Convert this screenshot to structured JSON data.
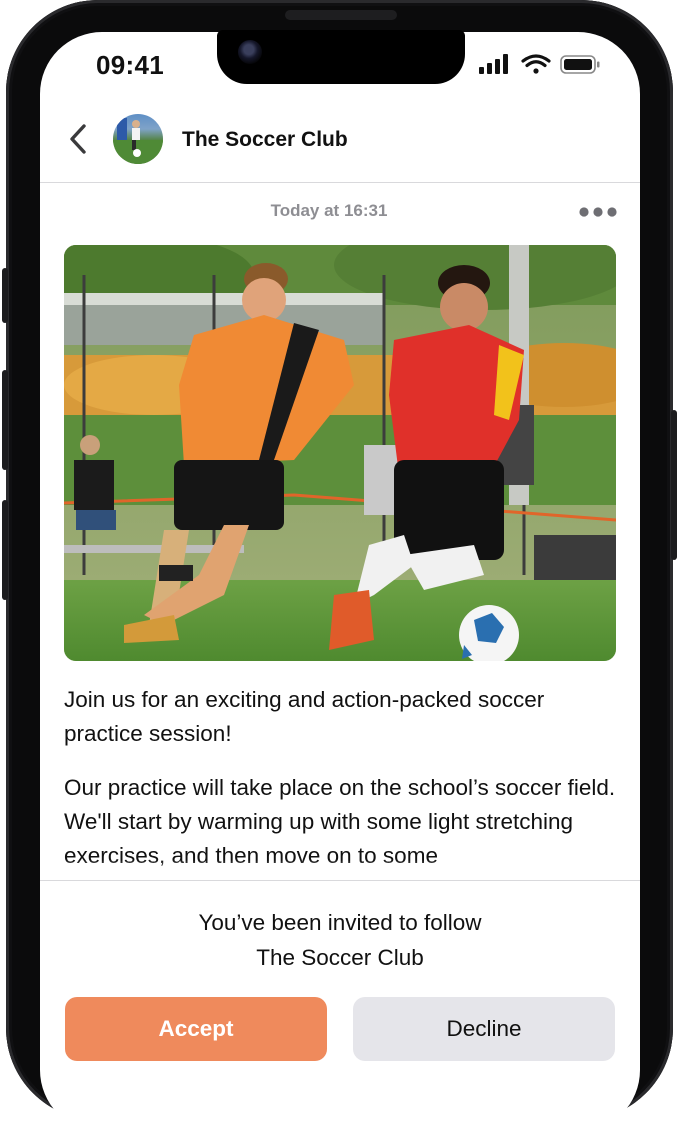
{
  "status_bar": {
    "time": "09:41"
  },
  "header": {
    "club_name": "The Soccer Club"
  },
  "post": {
    "timestamp": "Today at 16:31",
    "paragraphs": [
      "Join us for an exciting and action-packed soccer practice session!",
      "Our practice will take place on the school’s soccer field. We'll start by warming up with some light stretching exercises, and then move on to some"
    ]
  },
  "invite": {
    "line1": "You’ve been invited to follow",
    "line2": "The Soccer Club"
  },
  "buttons": {
    "accept": "Accept",
    "decline": "Decline"
  },
  "colors": {
    "accent": "#ef8a5c",
    "secondary_button": "#e5e5ea",
    "muted_text": "#8e8e93"
  }
}
